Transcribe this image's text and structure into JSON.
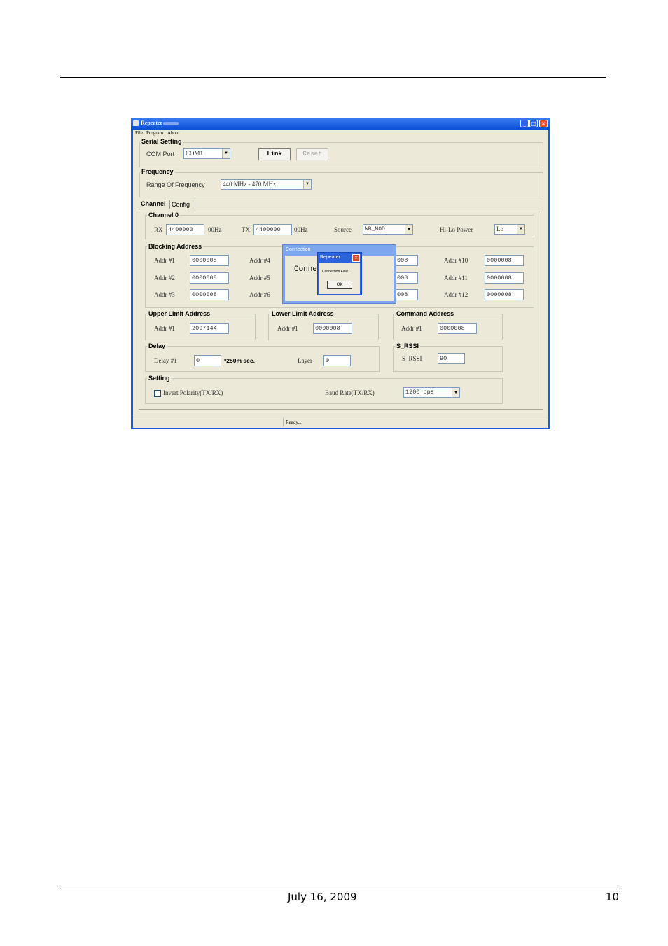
{
  "window": {
    "title": "Repeater",
    "menu": [
      "File",
      "Program",
      "About"
    ]
  },
  "serial": {
    "group_label": "Serial Setting",
    "com_port_label": "COM Port",
    "com_port_value": "COM1",
    "link_label": "Link",
    "reset_label": "Reset"
  },
  "frequency": {
    "group_label": "Frequency",
    "range_label": "Range Of Frequency",
    "range_value": "440 MHz - 470 MHz"
  },
  "tabs": [
    "Channel",
    "Config"
  ],
  "channel0": {
    "group_label": "Channel 0",
    "rx_label": "RX",
    "rx_value": "4400000",
    "rx_unit": "00Hz",
    "tx_label": "TX",
    "tx_value": "4400000",
    "tx_unit": "00Hz",
    "source_label": "Source",
    "source_value": "WB_MOD",
    "power_label": "Hi-Lo Power",
    "power_value": "Lo"
  },
  "blocking": {
    "group_label": "Blocking Address",
    "col1": [
      {
        "label": "Addr #1",
        "value": "0000008"
      },
      {
        "label": "Addr #2",
        "value": "0000008"
      },
      {
        "label": "Addr #3",
        "value": "0000008"
      }
    ],
    "col2": [
      {
        "label": "Addr #4",
        "value": "008"
      },
      {
        "label": "Addr #5",
        "value": "008"
      },
      {
        "label": "Addr #6",
        "value": "008"
      }
    ],
    "col4": [
      {
        "label": "Addr #10",
        "value": "0000008"
      },
      {
        "label": "Addr #11",
        "value": "0000008"
      },
      {
        "label": "Addr #12",
        "value": "0000008"
      }
    ]
  },
  "upper": {
    "group_label": "Upper Limit Address",
    "addr_label": "Addr #1",
    "addr_value": "2097144"
  },
  "lower": {
    "group_label": "Lower Limit Address",
    "addr_label": "Addr #1",
    "addr_value": "0000008"
  },
  "command": {
    "group_label": "Command Address",
    "addr_label": "Addr #1",
    "addr_value": "0000008"
  },
  "delay": {
    "group_label": "Delay",
    "delay_label": "Delay #1",
    "delay_value": "0",
    "delay_unit": "*250m sec.",
    "layer_label": "Layer",
    "layer_value": "0"
  },
  "srssi": {
    "group_label": "S_RSSI",
    "label": "S_RSSI",
    "value": "90"
  },
  "setting": {
    "group_label": "Setting",
    "invert_label": "Invert Polarity(TX/RX)",
    "invert_checked": false,
    "baud_label": "Baud Rate(TX/RX)",
    "baud_value": "1200 bps"
  },
  "status": {
    "text": "Ready...."
  },
  "connection_dialog": {
    "title": "Connection",
    "text": "Conne              ...."
  },
  "alert_dialog": {
    "title": "Repeater",
    "message": "Connection Fail !",
    "ok_label": "OK"
  },
  "footer": {
    "date": "July 16, 2009",
    "page": "10"
  }
}
